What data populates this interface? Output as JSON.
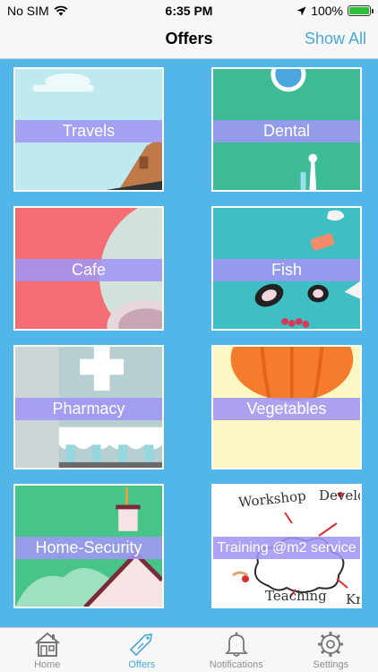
{
  "status_bar": {
    "carrier": "No SIM",
    "time": "6:35 PM",
    "battery": "100%"
  },
  "nav": {
    "title": "Offers",
    "action": "Show All"
  },
  "offers": [
    {
      "label": "Travels"
    },
    {
      "label": "Dental"
    },
    {
      "label": "Cafe"
    },
    {
      "label": "Fish"
    },
    {
      "label": "Pharmacy"
    },
    {
      "label": "Vegetables"
    },
    {
      "label": "Home-Security"
    },
    {
      "label": "Training @m2 service"
    }
  ],
  "training_words": {
    "w1": "Workshop",
    "w2": "Develop",
    "w3": "Teaching",
    "w4": "Kno"
  },
  "tab_bar": {
    "items": [
      {
        "label": "Home",
        "icon": "house-icon"
      },
      {
        "label": "Offers",
        "icon": "tag-icon"
      },
      {
        "label": "Notifications",
        "icon": "bell-icon"
      },
      {
        "label": "Settings",
        "icon": "gear-icon"
      }
    ],
    "active": "Offers"
  },
  "colors": {
    "accent": "#48a9d9",
    "grid_background": "#52b7e8",
    "label_band": "#a096f5"
  }
}
